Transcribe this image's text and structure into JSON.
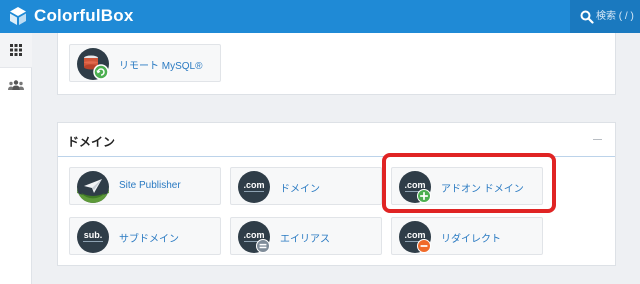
{
  "app": {
    "logo_text": "ColorfulBox",
    "search_placeholder": "検索 ( / )"
  },
  "rail": {
    "items": [
      {
        "icon": "grid-icon",
        "active": true
      },
      {
        "icon": "users-icon",
        "active": false
      }
    ]
  },
  "top_panel": {
    "items": [
      {
        "label": "リモート MySQL®",
        "icon": "mysql-icon"
      }
    ]
  },
  "domain_panel": {
    "title": "ドメイン",
    "items": [
      {
        "label": "Site Publisher",
        "icon": "paper-plane-icon"
      },
      {
        "label": "ドメイン",
        "icon": "domain-com-icon",
        "icon_text": ".com"
      },
      {
        "label": "アドオン ドメイン",
        "icon": "addon-domain-icon",
        "icon_text": ".com"
      },
      {
        "label": "サブドメイン",
        "icon": "subdomain-icon",
        "icon_text": "sub."
      },
      {
        "label": "エイリアス",
        "icon": "alias-icon",
        "icon_text": ".com"
      },
      {
        "label": "リダイレクト",
        "icon": "redirect-icon",
        "icon_text": ".com"
      }
    ]
  },
  "colors": {
    "topbar": "#1f8ad6",
    "link": "#2a7ac2",
    "highlight": "#e02424",
    "badge_green": "#4caf50",
    "badge_gray": "#7f8c99",
    "badge_orange": "#f06a2a"
  }
}
